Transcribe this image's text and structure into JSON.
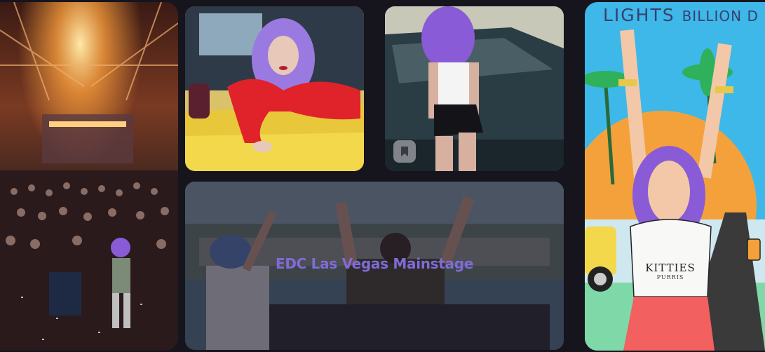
{
  "gallery": {
    "tiles": [
      {
        "name": "concert-crowd-photo",
        "caption": ""
      },
      {
        "name": "purple-hair-yellow-car-photo",
        "caption": ""
      },
      {
        "name": "purple-hair-dark-car-photo",
        "caption": ""
      },
      {
        "name": "mainstage-photo",
        "caption": "EDC Las Vegas Mainstage"
      },
      {
        "name": "illustrated-poster",
        "caption": ""
      }
    ],
    "poster": {
      "title_main": "LIGHTS",
      "title_tail": "BILLION D",
      "shirt_text": "KITTIES",
      "shirt_sub": "PURRIS"
    },
    "bookmark_icon": "bookmark-icon"
  },
  "colors": {
    "background": "#16141c",
    "caption": "#7f6bd6",
    "poster_sky": "#3db8e8",
    "poster_sun": "#f5a13b",
    "hair_purple": "#8a5bd6"
  }
}
